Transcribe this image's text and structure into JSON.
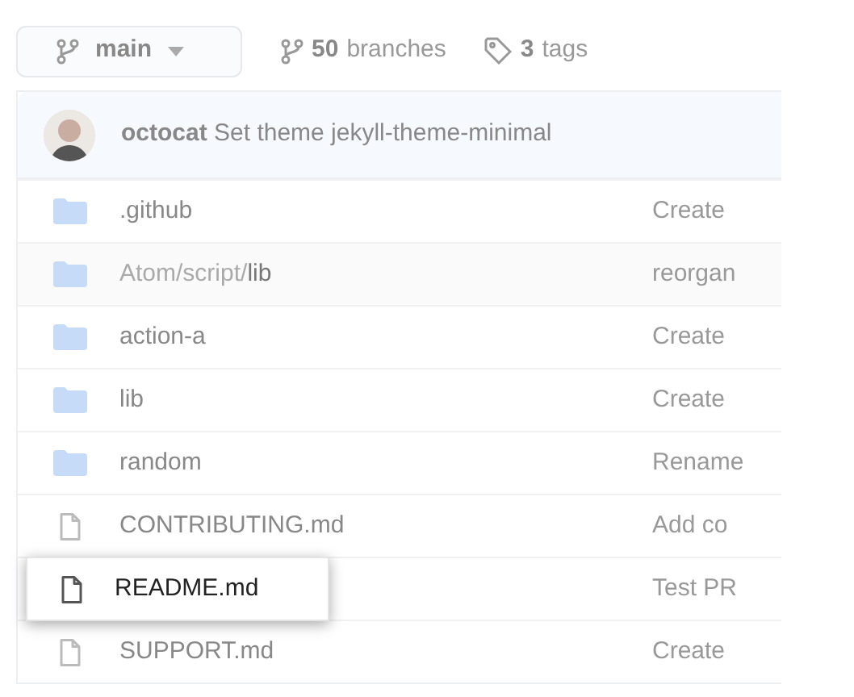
{
  "branch_selector": {
    "label": "main"
  },
  "branches": {
    "count": "50",
    "label": "branches"
  },
  "tags": {
    "count": "3",
    "label": "tags"
  },
  "latest_commit": {
    "author": "octocat",
    "message": "Set theme jekyll-theme-minimal"
  },
  "files": [
    {
      "kind": "folder",
      "name": ".github",
      "commit_message": "Create",
      "hovered": false,
      "highlighted": false
    },
    {
      "kind": "folder",
      "path_prefix": "Atom/script/",
      "name": "lib",
      "commit_message": "reorgan",
      "hovered": true,
      "highlighted": false
    },
    {
      "kind": "folder",
      "name": "action-a",
      "commit_message": "Create",
      "hovered": false,
      "highlighted": false
    },
    {
      "kind": "folder",
      "name": "lib",
      "commit_message": "Create",
      "hovered": false,
      "highlighted": false
    },
    {
      "kind": "folder",
      "name": "random",
      "commit_message": "Rename",
      "hovered": false,
      "highlighted": false
    },
    {
      "kind": "file",
      "name": "CONTRIBUTING.md",
      "commit_message": "Add co",
      "hovered": false,
      "highlighted": false
    },
    {
      "kind": "file",
      "name": "README.md",
      "commit_message": "Test PR",
      "hovered": false,
      "highlighted": true
    },
    {
      "kind": "file",
      "name": "SUPPORT.md",
      "commit_message": "Create",
      "hovered": false,
      "highlighted": false
    }
  ]
}
